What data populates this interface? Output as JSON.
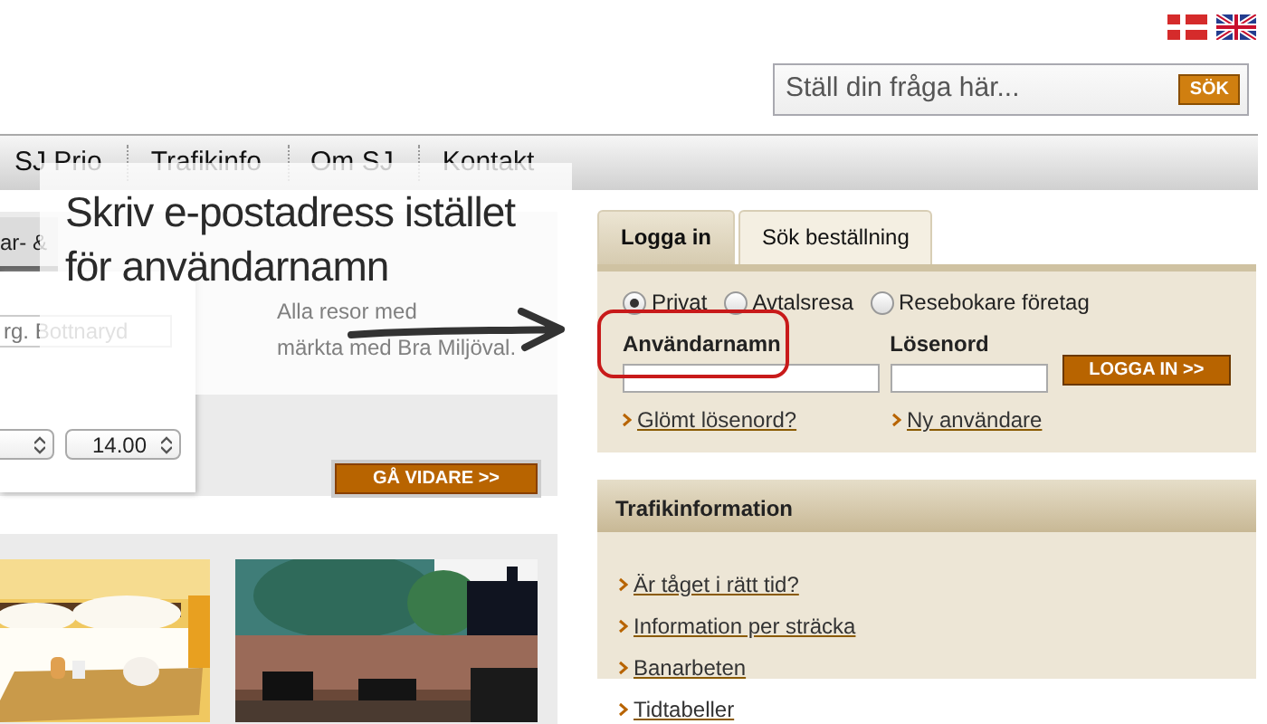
{
  "search": {
    "placeholder": "Ställ din fråga här...",
    "button": "SÖK"
  },
  "nav": [
    "SJ Prio",
    "Trafikinfo",
    "Om SJ",
    "Kontakt"
  ],
  "booking": {
    "tab": "ar- &",
    "place_placeholder": "rg. Bottnaryd",
    "time": "14.00",
    "promo_lines": [
      "Alla resor med",
      "märkta med Bra Miljöval."
    ],
    "button": "GÅ VIDARE >>"
  },
  "annotation": {
    "lines": [
      "Skriv e-postadress istället",
      "för användarnamn"
    ]
  },
  "login": {
    "tabs": [
      {
        "label": "Logga in",
        "selected": true
      },
      {
        "label": "Sök beställning",
        "selected": false
      }
    ],
    "account_types": [
      {
        "label": "Privat",
        "selected": true
      },
      {
        "label": "Avtalsresa",
        "selected": false
      },
      {
        "label": "Resebokare företag",
        "selected": false
      }
    ],
    "username_label": "Användarnamn",
    "password_label": "Lösenord",
    "button": "LOGGA IN >>",
    "links": [
      "Glömt lösenord?",
      "Ny användare"
    ]
  },
  "traffic": {
    "title": "Trafikinformation",
    "links": [
      "Är tåget i rätt tid?",
      "Information per sträcka",
      "Banarbeten",
      "Tidtabeller"
    ]
  }
}
